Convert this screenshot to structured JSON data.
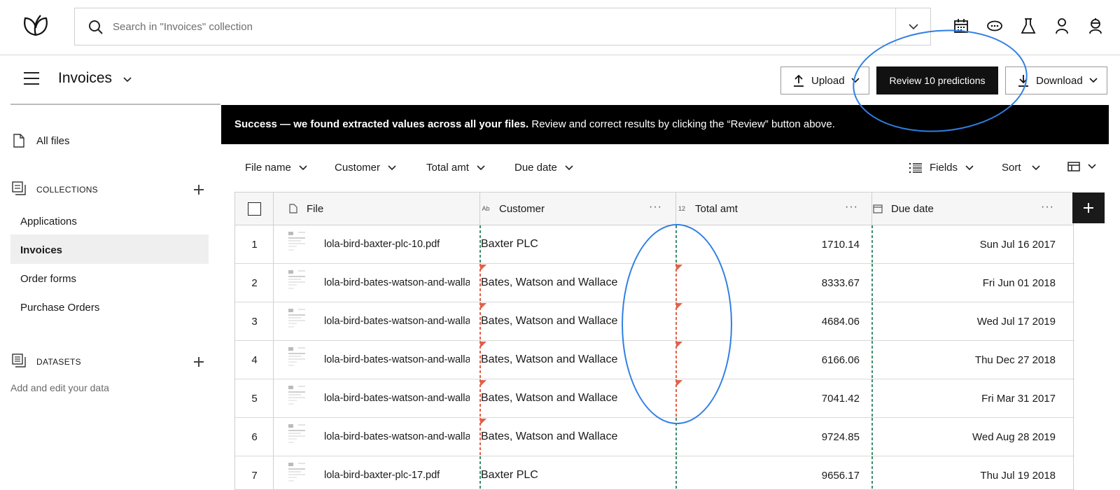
{
  "topbar": {
    "search_placeholder": "Search in \"Invoices\" collection",
    "icons": [
      "calendar-icon",
      "chat-icon",
      "flask-icon",
      "user-icon",
      "robot-icon"
    ]
  },
  "header": {
    "title": "Invoices",
    "upload_label": "Upload",
    "review_label": "Review 10 predictions",
    "download_label": "Download"
  },
  "sidebar": {
    "all_files": "All files",
    "collections_label": "COLLECTIONS",
    "collections": [
      {
        "label": "Applications",
        "selected": false
      },
      {
        "label": "Invoices",
        "selected": true
      },
      {
        "label": "Order forms",
        "selected": false
      },
      {
        "label": "Purchase Orders",
        "selected": false
      }
    ],
    "datasets_label": "DATASETS",
    "datasets_hint": "Add and edit your data"
  },
  "banner": {
    "bold": "Success — we found extracted values across all your files.",
    "text": " Review and correct results by clicking the “Review” button above."
  },
  "filters": {
    "items": [
      "File name",
      "Customer",
      "Total amt",
      "Due date"
    ],
    "fields_label": "Fields",
    "sort_label": "Sort"
  },
  "table": {
    "headers": {
      "file": "File",
      "customer": "Customer",
      "customer_type": "Ab",
      "total": "Total amt",
      "total_type": "12",
      "due": "Due date"
    },
    "rows": [
      {
        "n": "1",
        "file": "lola-bird-baxter-plc-10.pdf",
        "customer": "Baxter PLC",
        "total": "1710.14",
        "due": "Sun Jul 16 2017",
        "flag_customer": false,
        "flag_total": false
      },
      {
        "n": "2",
        "file": "lola-bird-bates-watson-and-wallace",
        "customer": "Bates, Watson and Wallace",
        "total": "8333.67",
        "due": "Fri Jun 01 2018",
        "flag_customer": true,
        "flag_total": true
      },
      {
        "n": "3",
        "file": "lola-bird-bates-watson-and-wallace",
        "customer": "Bates, Watson and Wallace",
        "total": "4684.06",
        "due": "Wed Jul 17 2019",
        "flag_customer": true,
        "flag_total": true
      },
      {
        "n": "4",
        "file": "lola-bird-bates-watson-and-wallace",
        "customer": "Bates, Watson and Wallace",
        "total": "6166.06",
        "due": "Thu Dec 27 2018",
        "flag_customer": true,
        "flag_total": true
      },
      {
        "n": "5",
        "file": "lola-bird-bates-watson-and-wallace",
        "customer": "Bates, Watson and Wallace",
        "total": "7041.42",
        "due": "Fri Mar 31 2017",
        "flag_customer": true,
        "flag_total": true
      },
      {
        "n": "6",
        "file": "lola-bird-bates-watson-and-wallace",
        "customer": "Bates, Watson and Wallace",
        "total": "9724.85",
        "due": "Wed Aug 28 2019",
        "flag_customer": true,
        "flag_total": false
      },
      {
        "n": "7",
        "file": "lola-bird-baxter-plc-17.pdf",
        "customer": "Baxter PLC",
        "total": "9656.17",
        "due": "Thu Jul 19 2018",
        "flag_customer": false,
        "flag_total": false
      }
    ]
  },
  "colors": {
    "flag": "#e0614a",
    "confirmed": "#3f8f6c",
    "annotation": "#2f7fe3",
    "banner_bg": "#000000"
  }
}
